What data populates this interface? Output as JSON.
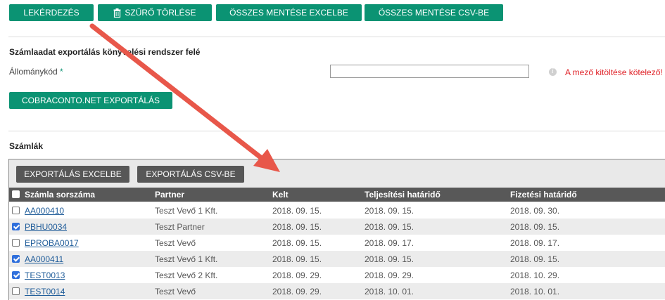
{
  "toolbar": {
    "query_label": "LEKÉRDEZÉS",
    "clear_filter_label": "SZŰRŐ TÖRLÉSE",
    "save_excel_label": "ÖSSZES MENTÉSE EXCELBE",
    "save_csv_label": "ÖSSZES MENTÉSE CSV-BE"
  },
  "export_section": {
    "title": "Számlaadat exportálás könyvelési rendszer felé",
    "field_label": "Állománykód",
    "required_mark": "*",
    "field_value": "",
    "info_icon": "i",
    "error_text": "A mező kitöltése kötelező!",
    "export_button_label": "COBRACONTO.NET EXPORTÁLÁS"
  },
  "invoices": {
    "title": "Számlák",
    "export_excel_label": "EXPORTÁLÁS EXCELBE",
    "export_csv_label": "EXPORTÁLÁS CSV-BE",
    "columns": [
      "Számla sorszáma",
      "Partner",
      "Kelt",
      "Teljesítési határidő",
      "Fizetési határidő"
    ],
    "rows": [
      {
        "number": "AA000410",
        "partner": "Teszt Vevő 1 Kft.",
        "date": "2018. 09. 15.",
        "fulfillment": "2018. 09. 15.",
        "payment": "2018. 09. 30.",
        "checked": false
      },
      {
        "number": "PBHU0034",
        "partner": "Teszt Partner",
        "date": "2018. 09. 15.",
        "fulfillment": "2018. 09. 15.",
        "payment": "2018. 09. 15.",
        "checked": true
      },
      {
        "number": "EPROBA0017",
        "partner": "Teszt Vevő",
        "date": "2018. 09. 15.",
        "fulfillment": "2018. 09. 17.",
        "payment": "2018. 09. 17.",
        "checked": false
      },
      {
        "number": "AA000411",
        "partner": "Teszt Vevő 1 Kft.",
        "date": "2018. 09. 15.",
        "fulfillment": "2018. 09. 15.",
        "payment": "2018. 09. 15.",
        "checked": true
      },
      {
        "number": "TEST0013",
        "partner": "Teszt Vevő 2 Kft.",
        "date": "2018. 09. 29.",
        "fulfillment": "2018. 09. 29.",
        "payment": "2018. 10. 29.",
        "checked": true
      },
      {
        "number": "TEST0014",
        "partner": "Teszt Vevő",
        "date": "2018. 09. 29.",
        "fulfillment": "2018. 10. 01.",
        "payment": "2018. 10. 01.",
        "checked": false
      }
    ]
  },
  "colors": {
    "accent_green": "#0b9373",
    "annotation_arrow": "#e8574a",
    "error_red": "#e0242a",
    "table_header": "#585858"
  }
}
